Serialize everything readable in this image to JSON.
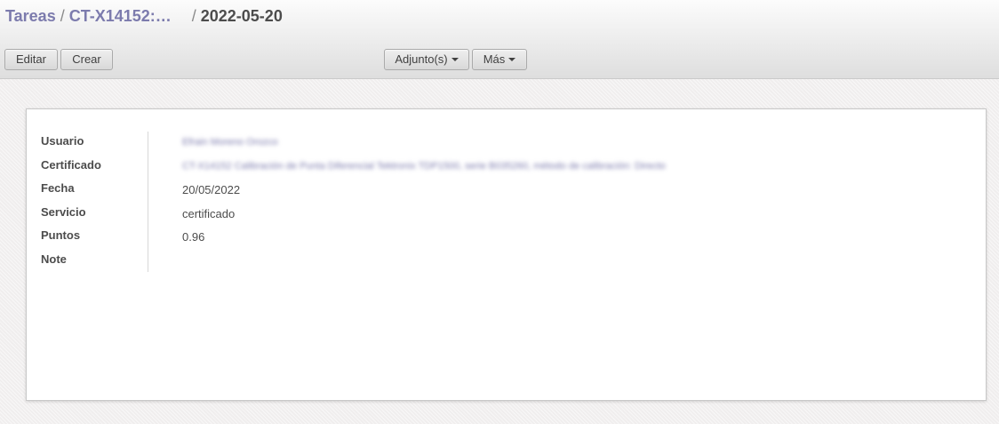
{
  "breadcrumb": {
    "root": "Tareas",
    "sep1": "/",
    "parent": "CT-X14152:…",
    "sep2": "/",
    "current": "2022-05-20"
  },
  "buttons": {
    "edit": "Editar",
    "create": "Crear",
    "attachments": "Adjunto(s)",
    "more": "Más"
  },
  "form": {
    "fields": [
      {
        "label": "Usuario",
        "value": "Efrain Moreno Orozco",
        "blurred": true
      },
      {
        "label": "Certificado",
        "value": "CT-X14152 Calibración de Punta Diferencial Tektronix TDP1500, serie B035260, método de calibración: Directo",
        "blurred": true
      },
      {
        "label": "Fecha",
        "value": "20/05/2022",
        "blurred": false
      },
      {
        "label": "Servicio",
        "value": "certificado",
        "blurred": false
      },
      {
        "label": "Puntos",
        "value": "0.96",
        "blurred": false
      },
      {
        "label": "Note",
        "value": "",
        "blurred": false
      }
    ]
  },
  "icons": {
    "dropdown": "caret-down-icon"
  }
}
